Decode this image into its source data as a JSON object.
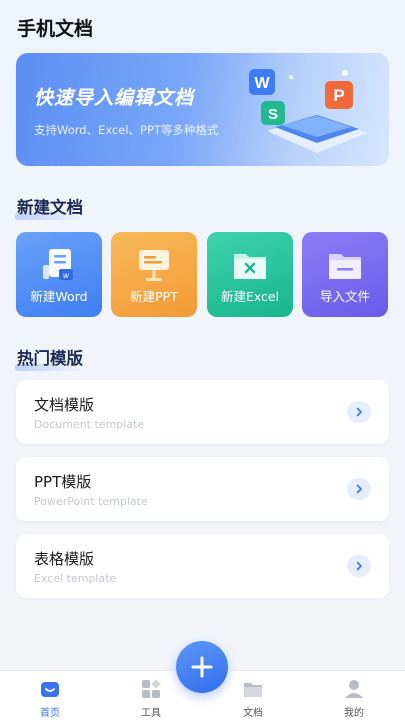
{
  "header": {
    "title": "手机文档"
  },
  "banner": {
    "title": "快速导入编辑文档",
    "subtitle": "支持Word、Excel、PPT等多种格式",
    "art_letters": {
      "w": "W",
      "p": "P",
      "s": "S"
    }
  },
  "new_doc": {
    "section_title": "新建文档",
    "tiles": [
      {
        "label": "新建Word",
        "icon": "word-doc-icon"
      },
      {
        "label": "新建PPT",
        "icon": "presentation-board-icon"
      },
      {
        "label": "新建Excel",
        "icon": "excel-folder-icon"
      },
      {
        "label": "导入文件",
        "icon": "folder-icon"
      }
    ]
  },
  "templates": {
    "section_title": "热门模版",
    "items": [
      {
        "title": "文档模版",
        "subtitle": "Document template"
      },
      {
        "title": "PPT模版",
        "subtitle": "PowerPoint template"
      },
      {
        "title": "表格模版",
        "subtitle": "Excel template"
      }
    ]
  },
  "tabbar": {
    "tabs": [
      {
        "label": "首页",
        "icon": "home-icon",
        "active": true
      },
      {
        "label": "工具",
        "icon": "tools-grid-icon",
        "active": false
      },
      {
        "label": "文档",
        "icon": "folder-icon",
        "active": false
      },
      {
        "label": "我的",
        "icon": "user-icon",
        "active": false
      }
    ],
    "fab_icon": "plus-icon"
  },
  "colors": {
    "accent": "#3a73ee",
    "word": "#3f7ef2",
    "ppt": "#f29a35",
    "excel": "#19b58c",
    "import": "#6b5ae8"
  }
}
